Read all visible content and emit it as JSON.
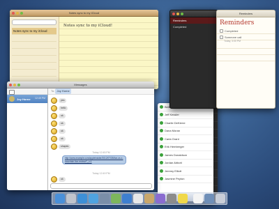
{
  "notes": {
    "title": "Notes sync to my iCloud",
    "list": [
      "Notes sync to my iCloud",
      "",
      "",
      "",
      "",
      "",
      "",
      "",
      ""
    ],
    "body": "Notes sync to my iCloud!"
  },
  "messages": {
    "title": "Messages",
    "conversation": {
      "name": "Joy Horne",
      "time": "12:49 PM",
      "preview": ""
    },
    "to_label": "To:",
    "recipient": "Joy Horne",
    "replies": [
      "yes",
      "hello",
      "ok",
      "ok",
      "ok",
      "ok",
      "shapes"
    ],
    "timestamps": [
      "Today 12:45 PM",
      "Today 12:49 PM"
    ],
    "link_text": "http://www.example.com/appleinsider/2012/07/25/lion-os-x-mountain-lion-review/?_r=1"
  },
  "reminders": {
    "title": "Reminders",
    "heading": "Reminders",
    "sidebar_items": [
      "Reminders",
      "Completed"
    ],
    "items": [
      {
        "text": "Completed",
        "sub": ""
      },
      {
        "text": "Someone call",
        "sub": "Today, 3:00 PM"
      },
      {
        "text": "",
        "sub": ""
      },
      {
        "text": "",
        "sub": ""
      },
      {
        "text": "",
        "sub": ""
      }
    ]
  },
  "contacts": {
    "names": [
      "Belinda Black",
      "Jeff Kessler",
      "Charlie DeKlerre",
      "Dana Moran",
      "Carla Grant",
      "Erik Hemberger",
      "James Donaldson",
      "Jordan Abbott",
      "Jeremy Elliott",
      "Jasmine Peyton"
    ]
  },
  "dark_sidebar": {
    "items": [
      "Belinda Black",
      "Jeff Kessler",
      "Charlie DeKlerre",
      "Dana Moran",
      "Carla Grant",
      "Erik Hemberger",
      "James Donaldson",
      "Jordan Abbott",
      "Jeremy Elliott",
      "Jasmine Peyton",
      "",
      "",
      "",
      "",
      "",
      "",
      "",
      "",
      "",
      "",
      "",
      "",
      "",
      "",
      ""
    ]
  },
  "dock": {
    "icons": [
      "finder-icon",
      "launchpad-icon",
      "app-store-icon",
      "safari-icon",
      "mail-icon",
      "facetime-icon",
      "messages-icon",
      "calendar-icon",
      "photos-icon",
      "itunes-icon",
      "system-prefs-icon",
      "notes-icon",
      "reminders-icon",
      "folder-icon",
      "trash-icon"
    ],
    "colors": [
      "#4a90d9",
      "#c0c4cc",
      "#3d8fd6",
      "#4fa3e0",
      "#7a8ea8",
      "#7db65c",
      "#3e7fd0",
      "#e8e8e8",
      "#c9a76b",
      "#8a6cd0",
      "#8c8c8c",
      "#f0d84a",
      "#f4f4f4",
      "#6f8fb8",
      "#c9ced8"
    ]
  }
}
